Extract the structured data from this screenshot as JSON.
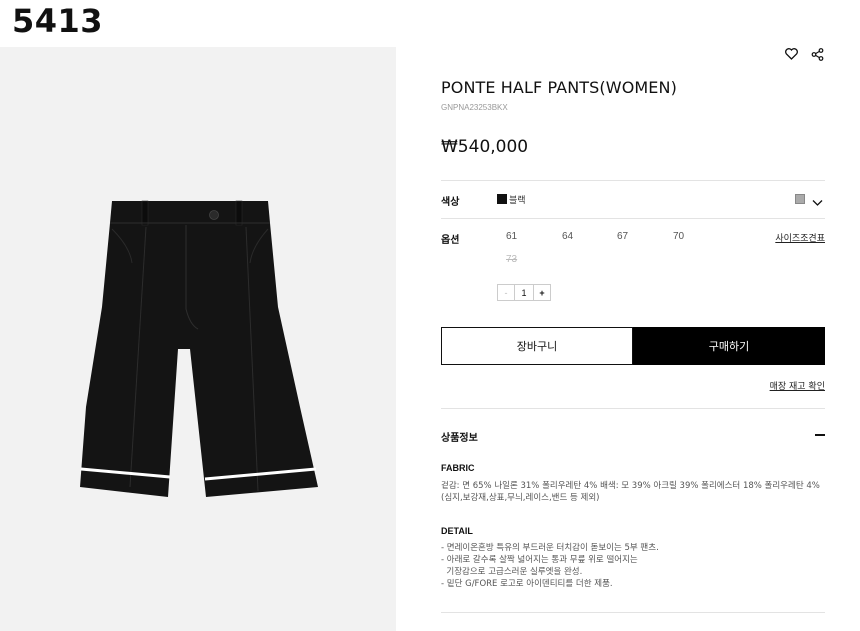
{
  "page_label": "5413",
  "product": {
    "title": "PONTE HALF PANTS(WOMEN)",
    "code": "GNPNA23253BKX",
    "price": "₩540,000"
  },
  "icons": {
    "wishlist": "heart-icon",
    "share": "share-icon",
    "dropdown": "chevron-down-icon",
    "collapse": "minus-icon"
  },
  "color_option": {
    "label": "색상",
    "selected_name": "블랙",
    "chip_color": "#111111"
  },
  "size_option": {
    "label": "옵션",
    "sizes": [
      "61",
      "64",
      "67",
      "70",
      "73"
    ],
    "sold_out_size": "73",
    "size_guide_label": "사이즈조견표"
  },
  "quantity": {
    "minus": "-",
    "value": "1",
    "plus": "+"
  },
  "buttons": {
    "cart": "장바구니",
    "buy": "구매하기"
  },
  "store_stock_link": "매장 재고 확인",
  "product_info": {
    "title": "상품정보",
    "fabric_heading": "FABRIC",
    "fabric_lines": [
      "겉감: 면 65% 나일론 31% 폴리우레탄 4% 배색: 모 39% 아크릴 39% 폴리에스터 18% 폴리우레탄 4%",
      "(심지,보강재,상표,무늬,레이스,밴드 등 제외)"
    ],
    "detail_heading": "DETAIL",
    "detail_lines": [
      "- 면레이온혼방 특유의 부드러운 터치감이 돋보이는 5부 팬츠.",
      "- 아래로 갈수록 살짝 넓어지는 통과 무릎 위로 떨어지는",
      "  기장감으로 고급스러운 실루엣을 완성.",
      "- 밑단 G/FORE 로고로 아이덴티티를 더한 제품."
    ]
  },
  "colors": {
    "accent": "#000000",
    "image_bg": "#f2f2f2",
    "garment": "#141414"
  }
}
